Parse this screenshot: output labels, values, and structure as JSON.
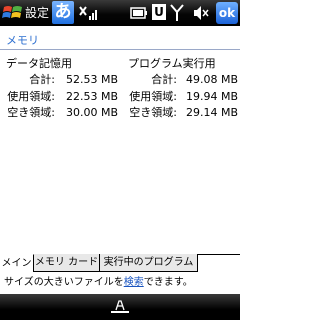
{
  "titlebar": {
    "app_title": "設定",
    "ime_char": "あ",
    "u_badge": "U",
    "ok_label": "ok",
    "icons": [
      "windows-start-icon",
      "ime-icon",
      "signal-off-icon",
      "battery-icon",
      "antenna-icon",
      "volume-mute-icon"
    ]
  },
  "page": {
    "title": "メモリ"
  },
  "storage": {
    "title": "データ記憶用",
    "total_label": "合計:",
    "total": "52.53 MB",
    "used_label": "使用領域:",
    "used": "22.53 MB",
    "free_label": "空き領域:",
    "free": "30.00 MB"
  },
  "program": {
    "title": "プログラム実行用",
    "total_label": "合計:",
    "total": "49.08 MB",
    "used_label": "使用領域:",
    "used": "19.94 MB",
    "free_label": "空き領域:",
    "free": "29.14 MB"
  },
  "tabs": [
    "メイン",
    "メモリ カード",
    "実行中のプログラム"
  ],
  "tip": {
    "prefix": "サイズの大きいファイルを",
    "link": "検索",
    "suffix": "できます。"
  },
  "colors": {
    "accent": "#2d6fd0",
    "bar": "#000000",
    "link": "#1a55c0"
  }
}
